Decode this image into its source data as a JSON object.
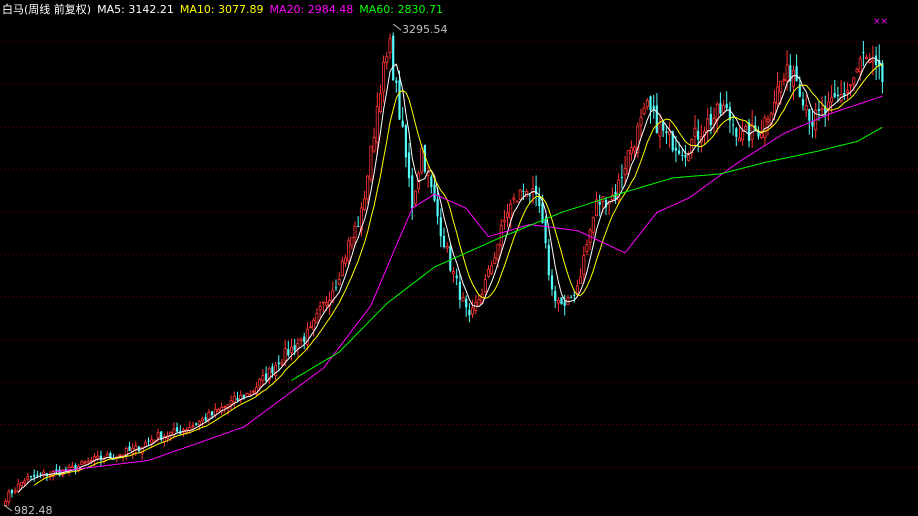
{
  "chart_data": {
    "type": "candlestick",
    "title": "白马(周线 前复权)",
    "legend": [
      {
        "label": "MA5:",
        "value": "3142.21",
        "color": "#ffffff"
      },
      {
        "label": "MA10:",
        "value": "3077.89",
        "color": "#ffff00"
      },
      {
        "label": "MA20:",
        "value": "2984.48",
        "color": "#ff00ff"
      },
      {
        "label": "MA60:",
        "value": "2830.71",
        "color": "#00ff00"
      }
    ],
    "y_min_label": "982.48",
    "y_max_label": "3295.54",
    "ylim": [
      950,
      3350
    ],
    "grid": true,
    "colors": {
      "up": "#ff3333",
      "down": "#54fcfc",
      "background": "#000000",
      "grid": "#800000",
      "text": "#c0c0c0"
    },
    "close_path": [
      [
        0,
        1000
      ],
      [
        6,
        1090
      ],
      [
        12,
        1115
      ],
      [
        20,
        1135
      ],
      [
        27,
        1182
      ],
      [
        35,
        1210
      ],
      [
        41,
        1240
      ],
      [
        47,
        1300
      ],
      [
        53,
        1320
      ],
      [
        59,
        1360
      ],
      [
        65,
        1410
      ],
      [
        71,
        1470
      ],
      [
        77,
        1520
      ],
      [
        82,
        1600
      ],
      [
        86,
        1680
      ],
      [
        91,
        1750
      ],
      [
        96,
        1820
      ],
      [
        100,
        1950
      ],
      [
        104,
        2070
      ],
      [
        108,
        2250
      ],
      [
        112,
        2400
      ],
      [
        115,
        2700
      ],
      [
        118,
        3050
      ],
      [
        121,
        3220
      ],
      [
        124,
        2900
      ],
      [
        128,
        2450
      ],
      [
        131,
        2720
      ],
      [
        135,
        2450
      ],
      [
        140,
        2150
      ],
      [
        146,
        1870
      ],
      [
        152,
        2100
      ],
      [
        158,
        2420
      ],
      [
        164,
        2540
      ],
      [
        168,
        2430
      ],
      [
        172,
        2020
      ],
      [
        176,
        1930
      ],
      [
        180,
        2050
      ],
      [
        186,
        2450
      ],
      [
        192,
        2500
      ],
      [
        196,
        2700
      ],
      [
        202,
        2920
      ],
      [
        208,
        2780
      ],
      [
        214,
        2720
      ],
      [
        220,
        2840
      ],
      [
        226,
        2920
      ],
      [
        232,
        2780
      ],
      [
        238,
        2830
      ],
      [
        244,
        3050
      ],
      [
        248,
        3120
      ],
      [
        254,
        2860
      ],
      [
        260,
        2930
      ],
      [
        266,
        3040
      ],
      [
        270,
        3180
      ],
      [
        276,
        3060
      ]
    ],
    "ma20_path": [
      [
        15,
        1128
      ],
      [
        45,
        1185
      ],
      [
        75,
        1350
      ],
      [
        100,
        1640
      ],
      [
        115,
        1950
      ],
      [
        122,
        2210
      ],
      [
        128,
        2430
      ],
      [
        135,
        2500
      ],
      [
        145,
        2430
      ],
      [
        152,
        2290
      ],
      [
        165,
        2350
      ],
      [
        180,
        2320
      ],
      [
        195,
        2210
      ],
      [
        205,
        2410
      ],
      [
        215,
        2480
      ],
      [
        230,
        2650
      ],
      [
        245,
        2800
      ],
      [
        260,
        2900
      ],
      [
        276,
        2984
      ]
    ],
    "ma60_path": [
      [
        90,
        1580
      ],
      [
        105,
        1720
      ],
      [
        120,
        1960
      ],
      [
        135,
        2140
      ],
      [
        155,
        2280
      ],
      [
        175,
        2410
      ],
      [
        195,
        2510
      ],
      [
        210,
        2580
      ],
      [
        225,
        2600
      ],
      [
        240,
        2660
      ],
      [
        255,
        2710
      ],
      [
        268,
        2760
      ],
      [
        276,
        2830
      ]
    ]
  }
}
